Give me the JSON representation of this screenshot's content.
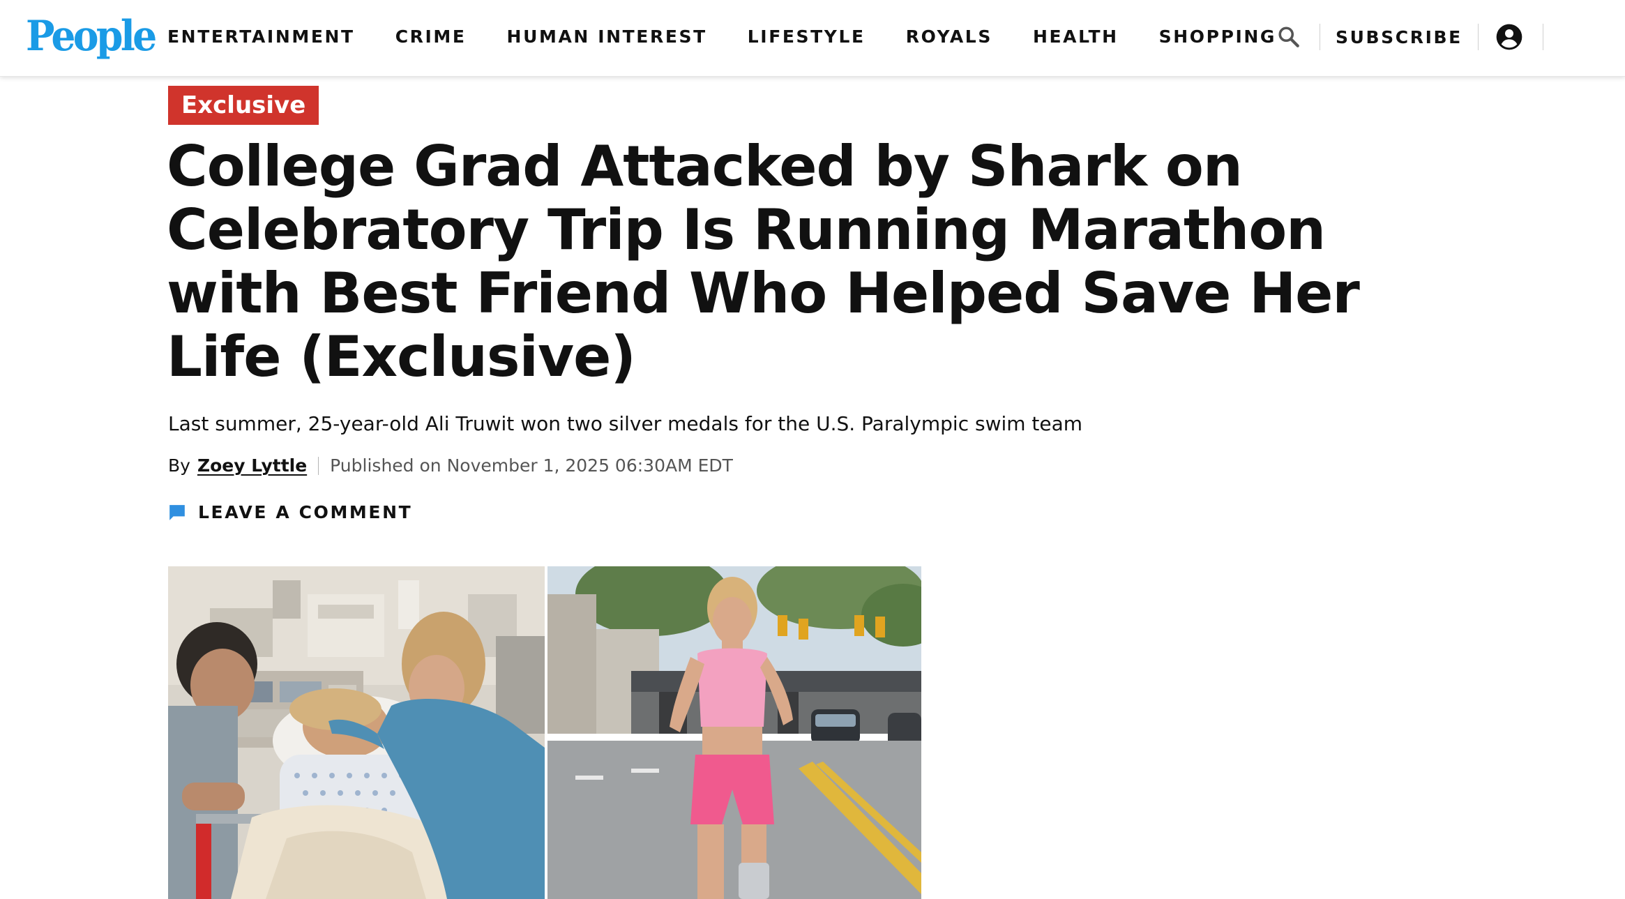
{
  "header": {
    "logo_text": "People",
    "nav": [
      {
        "label": "ENTERTAINMENT"
      },
      {
        "label": "CRIME"
      },
      {
        "label": "HUMAN INTEREST"
      },
      {
        "label": "LIFESTYLE"
      },
      {
        "label": "ROYALS"
      },
      {
        "label": "HEALTH"
      },
      {
        "label": "SHOPPING"
      }
    ],
    "search_icon": "search-icon",
    "subscribe_label": "SUBSCRIBE",
    "account_icon": "account-circle-icon"
  },
  "article": {
    "badge": "Exclusive",
    "headline": "College Grad Attacked by Shark on Celebratory Trip Is Running Marathon with Best Friend Who Helped Save Her Life (Exclusive)",
    "dek": "Last summer, 25-year-old Ali Truwit won two silver medals for the U.S. Paralympic swim team",
    "byline_prefix": "By",
    "author": "Zoey Lyttle",
    "published": "Published on November 1, 2025 06:30AM EDT",
    "comment_icon": "comment-icon",
    "comment_label": "LEAVE A COMMENT"
  },
  "hero": {
    "left_image": "hospital-bed-photo",
    "right_image": "runner-on-street-photo"
  },
  "colors": {
    "brand_blue": "#1a9be6",
    "badge_red": "#d0342c",
    "comment_blue": "#2f8fe0",
    "text": "#111111"
  }
}
